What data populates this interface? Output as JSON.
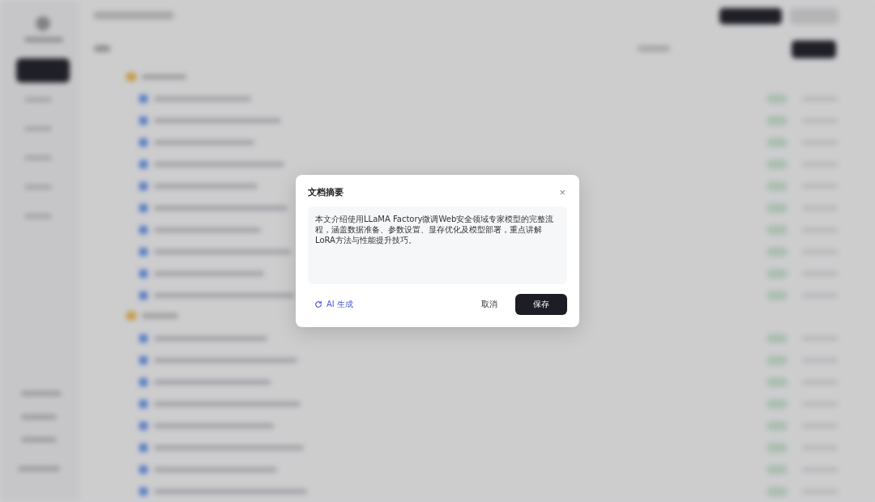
{
  "dialog": {
    "title": "文档摘要",
    "close": "×",
    "summary": "本文介绍使用LLaMA Factory微调Web安全领域专家模型的完整流程，涵盖数据准备、参数设置、显存优化及模型部署，重点讲解LoRA方法与性能提升技巧。",
    "ai_button": "AI 生成",
    "cancel_button": "取消",
    "save_button": "保存"
  }
}
